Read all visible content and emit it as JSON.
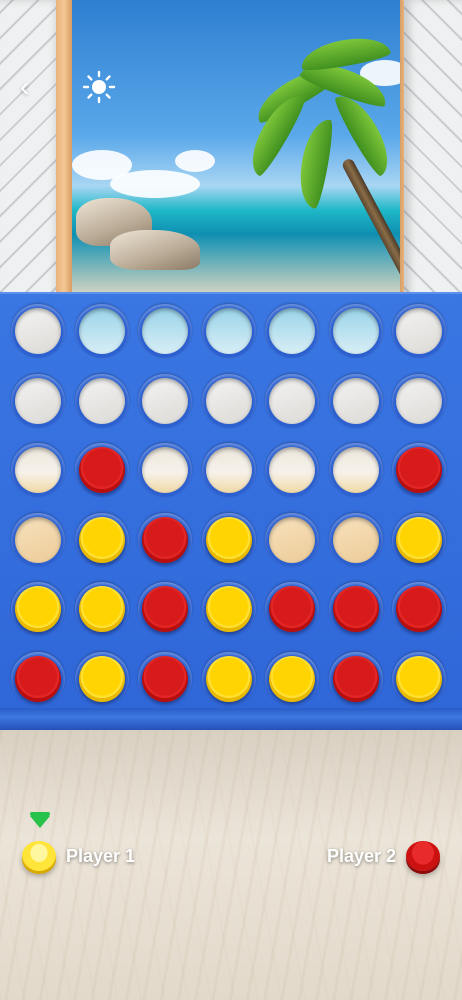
{
  "header": {
    "back_icon": "chevron-left-icon",
    "settings_icon": "sun-icon"
  },
  "board": {
    "columns": 7,
    "rows": 6,
    "grid": [
      [
        "empty-wall",
        "empty-sky",
        "empty-sky",
        "empty-sky",
        "empty-sky",
        "empty-sky",
        "empty-wall"
      ],
      [
        "empty-wall",
        "empty-wall",
        "empty-wall",
        "empty-wall",
        "empty-wall",
        "empty-wall",
        "empty-wall"
      ],
      [
        "empty-floor",
        "red",
        "empty-floor",
        "empty-floor",
        "empty-floor",
        "empty-floor",
        "red"
      ],
      [
        "empty-wood",
        "yellow",
        "red",
        "yellow",
        "empty-wood",
        "empty-wood",
        "yellow"
      ],
      [
        "yellow",
        "yellow",
        "red",
        "yellow",
        "red",
        "red",
        "red"
      ],
      [
        "red",
        "yellow",
        "red",
        "yellow",
        "yellow",
        "red",
        "yellow"
      ]
    ],
    "colors": {
      "board": "#3a77e3",
      "red": "#d71a1a",
      "yellow": "#ffd400",
      "turn_indicator": "#27c24a"
    }
  },
  "players": [
    {
      "name": "Player 1",
      "chip_color": "yellow",
      "active": true
    },
    {
      "name": "Player 2",
      "chip_color": "red",
      "active": false
    }
  ]
}
